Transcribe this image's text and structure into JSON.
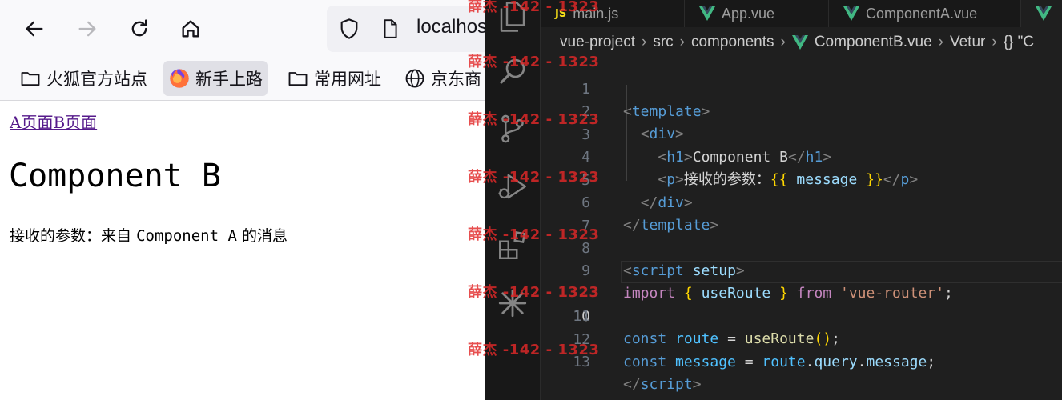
{
  "browser": {
    "url": "localhost",
    "bookmarks": [
      "火狐官方站点",
      "新手上路",
      "常用网址",
      "京东商"
    ],
    "page": {
      "link_a": "A页面",
      "link_b": "B页面",
      "heading": "Component B",
      "param_label": "接收的参数：",
      "param_value_prefix": "来自 ",
      "param_value_mono": "Component A",
      "param_value_suffix": " 的消息"
    }
  },
  "vscode": {
    "tabs": [
      "main.js",
      "App.vue",
      "ComponentA.vue"
    ],
    "tab_badge": "JS",
    "breadcrumb": [
      "vue-project",
      "src",
      "components",
      "ComponentB.vue",
      "Vetur",
      "{} \"C"
    ],
    "line_numbers": [
      "1",
      "2",
      "3",
      "4",
      "5",
      "6",
      "7",
      "8",
      "9",
      "10",
      "11",
      "12",
      "13"
    ],
    "current_line": "10",
    "code": {
      "template": "template",
      "div": "div",
      "h1": "h1",
      "h1_text": "Component B",
      "p": "p",
      "p_text": "接收的参数：",
      "open_mustache": "{{",
      "message": "message",
      "close_mustache": "}}",
      "script": "script",
      "setup": "setup",
      "import": "import",
      "useRoute": "useRoute",
      "from": "from",
      "module": "'vue-router'",
      "const": "const",
      "route": "route",
      "useRoute_call": "useRoute",
      "query": "query"
    }
  },
  "watermark": "薛杰 -142 - 1323",
  "colors": {
    "accent_vue": "#41b883",
    "js_badge": "#f5de19",
    "watermark": "#e22828"
  }
}
